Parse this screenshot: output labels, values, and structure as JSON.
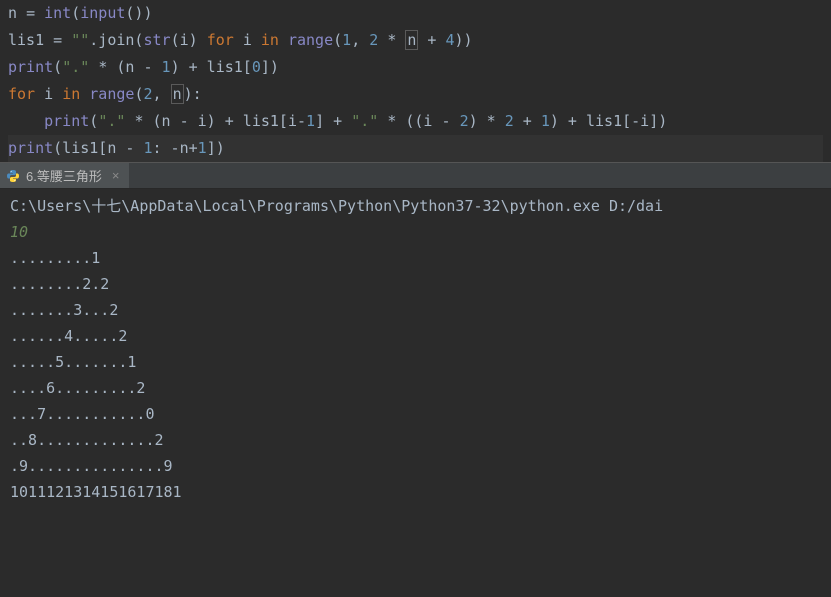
{
  "code": {
    "line1": {
      "tokens": [
        {
          "t": "n ",
          "c": "var"
        },
        {
          "t": "= ",
          "c": "op"
        },
        {
          "t": "int",
          "c": "builtin"
        },
        {
          "t": "(",
          "c": "paren"
        },
        {
          "t": "input",
          "c": "builtin"
        },
        {
          "t": "())",
          "c": "paren"
        }
      ]
    },
    "line2": {
      "tokens": [
        {
          "t": "lis1 ",
          "c": "var"
        },
        {
          "t": "= ",
          "c": "op"
        },
        {
          "t": "\"\"",
          "c": "str"
        },
        {
          "t": ".join(",
          "c": "var"
        },
        {
          "t": "str",
          "c": "builtin"
        },
        {
          "t": "(i) ",
          "c": "var"
        },
        {
          "t": "for ",
          "c": "kw"
        },
        {
          "t": "i ",
          "c": "var"
        },
        {
          "t": "in ",
          "c": "kw"
        },
        {
          "t": "range",
          "c": "builtin"
        },
        {
          "t": "(",
          "c": "paren"
        },
        {
          "t": "1",
          "c": "num"
        },
        {
          "t": ", ",
          "c": "op"
        },
        {
          "t": "2 ",
          "c": "num"
        },
        {
          "t": "* ",
          "c": "op"
        },
        {
          "t": "n",
          "c": "var",
          "box": true
        },
        {
          "t": " + ",
          "c": "op"
        },
        {
          "t": "4",
          "c": "num"
        },
        {
          "t": "))",
          "c": "paren"
        }
      ]
    },
    "line3": {
      "tokens": [
        {
          "t": "print",
          "c": "builtin"
        },
        {
          "t": "(",
          "c": "paren"
        },
        {
          "t": "\".\" ",
          "c": "str"
        },
        {
          "t": "* (n - ",
          "c": "var"
        },
        {
          "t": "1",
          "c": "num"
        },
        {
          "t": ") + lis1[",
          "c": "var"
        },
        {
          "t": "0",
          "c": "num"
        },
        {
          "t": "])",
          "c": "var"
        }
      ]
    },
    "line4": {
      "tokens": [
        {
          "t": "for ",
          "c": "kw"
        },
        {
          "t": "i ",
          "c": "var"
        },
        {
          "t": "in ",
          "c": "kw"
        },
        {
          "t": "range",
          "c": "builtin"
        },
        {
          "t": "(",
          "c": "paren"
        },
        {
          "t": "2",
          "c": "num"
        },
        {
          "t": ", ",
          "c": "op"
        },
        {
          "t": "n",
          "c": "var",
          "box": true
        },
        {
          "t": "):",
          "c": "var"
        }
      ]
    },
    "line5": {
      "tokens": [
        {
          "t": "    ",
          "c": "var"
        },
        {
          "t": "print",
          "c": "builtin"
        },
        {
          "t": "(",
          "c": "paren"
        },
        {
          "t": "\".\" ",
          "c": "str"
        },
        {
          "t": "* (n - i) + lis1[i-",
          "c": "var"
        },
        {
          "t": "1",
          "c": "num"
        },
        {
          "t": "] + ",
          "c": "var"
        },
        {
          "t": "\".\" ",
          "c": "str"
        },
        {
          "t": "* ((i - ",
          "c": "var"
        },
        {
          "t": "2",
          "c": "num"
        },
        {
          "t": ") * ",
          "c": "var"
        },
        {
          "t": "2 ",
          "c": "num"
        },
        {
          "t": "+ ",
          "c": "var"
        },
        {
          "t": "1",
          "c": "num"
        },
        {
          "t": ") + lis1[-i])",
          "c": "var"
        }
      ]
    },
    "line6": {
      "tokens": [
        {
          "t": "print",
          "c": "builtin"
        },
        {
          "t": "(lis1[n - ",
          "c": "var"
        },
        {
          "t": "1",
          "c": "num"
        },
        {
          "t": ": -n+",
          "c": "var"
        },
        {
          "t": "1",
          "c": "num"
        },
        {
          "t": "])",
          "c": "var"
        }
      ]
    }
  },
  "tab": {
    "label": "6.等腰三角形",
    "close": "×"
  },
  "console": {
    "cmd": "C:\\Users\\十七\\AppData\\Local\\Programs\\Python\\Python37-32\\python.exe D:/dai",
    "input": "10",
    "out1": ".........1",
    "out2": "........2.2",
    "out3": ".......3...2",
    "out4": "......4.....2",
    "out5": ".....5.......1",
    "out6": "....6.........2",
    "out7": "...7...........0",
    "out8": "..8.............2",
    "out9": ".9...............9",
    "out10": "1011121314151617181"
  }
}
